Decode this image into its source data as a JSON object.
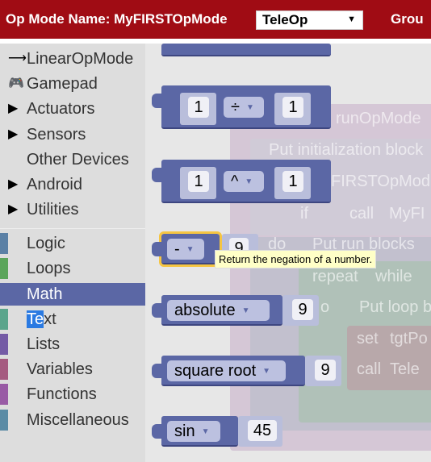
{
  "header": {
    "title": "Op Mode Name: MyFIRSTOpMode",
    "opmode_type": "TeleOp",
    "group_label": "Grou"
  },
  "sidebar": {
    "items": [
      {
        "label": "LinearOpMode",
        "icon": "arrow-right-icon"
      },
      {
        "label": "Gamepad",
        "icon": "gamepad-icon"
      },
      {
        "label": "Actuators",
        "icon": "triangle-right-icon"
      },
      {
        "label": "Sensors",
        "icon": "triangle-right-icon"
      },
      {
        "label": "Other Devices"
      },
      {
        "label": "Android",
        "icon": "triangle-right-icon"
      },
      {
        "label": "Utilities",
        "icon": "triangle-right-icon"
      }
    ],
    "categories": [
      {
        "label": "Logic",
        "color": "#5b80a5"
      },
      {
        "label": "Loops",
        "color": "#5ba55b"
      },
      {
        "label": "Math",
        "color": "#5b67a5",
        "selected": true
      },
      {
        "label_hl": "Te",
        "label_rest": "xt",
        "color": "#5ba58c"
      },
      {
        "label": "Lists",
        "color": "#745ba5"
      },
      {
        "label": "Variables",
        "color": "#a55b80"
      },
      {
        "label": "Functions",
        "color": "#995ba5"
      },
      {
        "label": "Miscellaneous",
        "color": "#5b8ba5"
      }
    ]
  },
  "blocks": {
    "divide": {
      "a": "1",
      "op": "÷",
      "b": "1"
    },
    "power": {
      "a": "1",
      "op": "^",
      "b": "1"
    },
    "negate": {
      "op": "-",
      "value": "9"
    },
    "absolute": {
      "op": "absolute",
      "value": "9"
    },
    "sqrt": {
      "op": "square root",
      "value": "9"
    },
    "sin": {
      "op": "sin",
      "value": "45"
    }
  },
  "background": {
    "run": "runOpMode",
    "init": "Put initialization block",
    "name": "FIRSTOpMod",
    "if": "if",
    "call1": "call",
    "myf": "MyFI",
    "do": "do",
    "putrun": "Put run blocks",
    "repeat": "repeat",
    "while": "while",
    "o": "o",
    "putloop": "Put loop b",
    "set": "set",
    "tgt": "tgtPo",
    "call2": "call",
    "tele": "Tele"
  },
  "tooltip": "Return the negation of a number."
}
